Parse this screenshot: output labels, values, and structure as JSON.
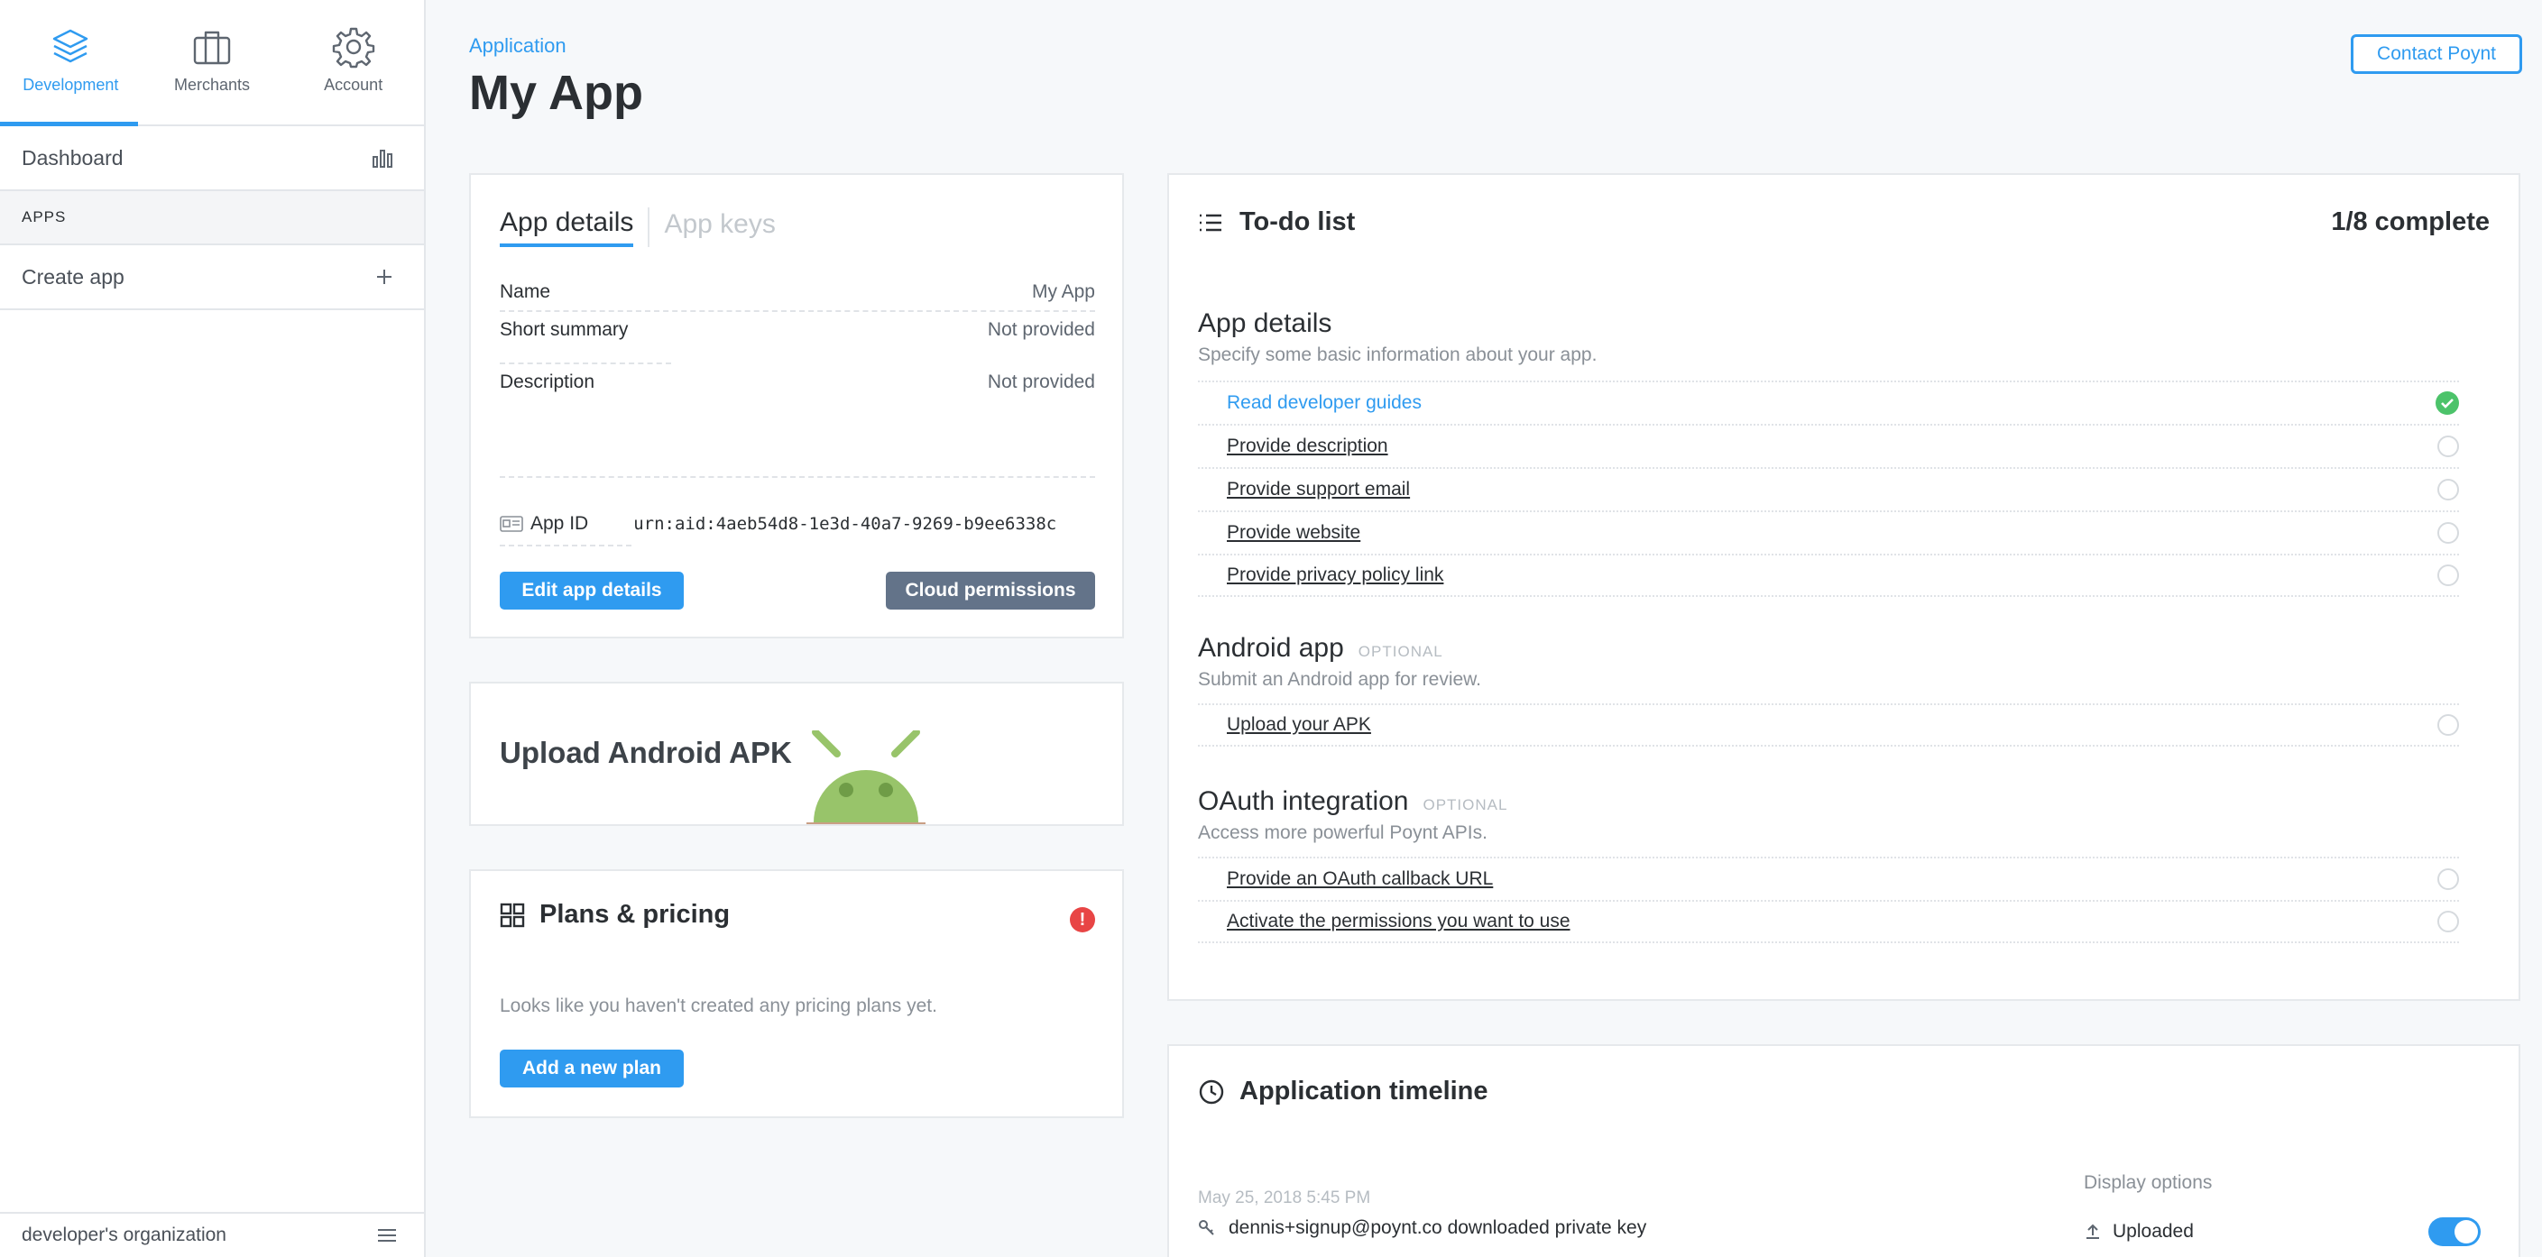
{
  "topnav": [
    {
      "label": "Development",
      "icon": "layers-icon",
      "active": true
    },
    {
      "label": "Merchants",
      "icon": "briefcase-icon",
      "active": false
    },
    {
      "label": "Account",
      "icon": "gear-icon",
      "active": false
    }
  ],
  "sidebar": {
    "dashboard_label": "Dashboard",
    "section_label": "APPS",
    "create_label": "Create app",
    "org_label": "developer's organization"
  },
  "header": {
    "breadcrumb": "Application",
    "title": "My App",
    "contact_label": "Contact Poynt"
  },
  "app_details": {
    "tab_details": "App details",
    "tab_keys": "App keys",
    "rows": [
      {
        "key": "Name",
        "value": "My App"
      },
      {
        "key": "Short summary",
        "value": "Not provided"
      },
      {
        "key": "Description",
        "value": "Not provided"
      }
    ],
    "app_id_label": "App ID",
    "app_id_value": "urn:aid:4aeb54d8-1e3d-40a7-9269-b9ee6338c",
    "edit_label": "Edit app details",
    "cloud_label": "Cloud permissions"
  },
  "apk": {
    "title": "Upload Android APK"
  },
  "plans": {
    "title": "Plans & pricing",
    "empty_text": "Looks like you haven't created any pricing plans yet.",
    "add_label": "Add a new plan"
  },
  "todo": {
    "title": "To-do list",
    "progress": "1/8 complete",
    "groups": [
      {
        "title": "App details",
        "optional": "",
        "desc": "Specify some basic information about your app.",
        "tasks": [
          {
            "label": "Read developer guides",
            "done": true
          },
          {
            "label": "Provide description",
            "done": false
          },
          {
            "label": "Provide support email",
            "done": false
          },
          {
            "label": "Provide website",
            "done": false
          },
          {
            "label": "Provide privacy policy link",
            "done": false
          }
        ]
      },
      {
        "title": "Android app",
        "optional": "OPTIONAL",
        "desc": "Submit an Android app for review.",
        "tasks": [
          {
            "label": "Upload your APK",
            "done": false
          }
        ]
      },
      {
        "title": "OAuth integration",
        "optional": "OPTIONAL",
        "desc": "Access more powerful Poynt APIs.",
        "tasks": [
          {
            "label": "Provide an OAuth callback URL",
            "done": false
          },
          {
            "label": "Activate the permissions you want to use",
            "done": false
          }
        ]
      }
    ]
  },
  "timeline": {
    "title": "Application timeline",
    "date": "May 25, 2018 5:45 PM",
    "event": "dennis+signup@poynt.co downloaded private key",
    "display_options_label": "Display options",
    "uploaded_label": "Uploaded",
    "uploaded_on": true
  },
  "colors": {
    "accent": "#2f9bf0",
    "success": "#4cc36a",
    "alert": "#e84545",
    "button_gray": "#637389"
  }
}
